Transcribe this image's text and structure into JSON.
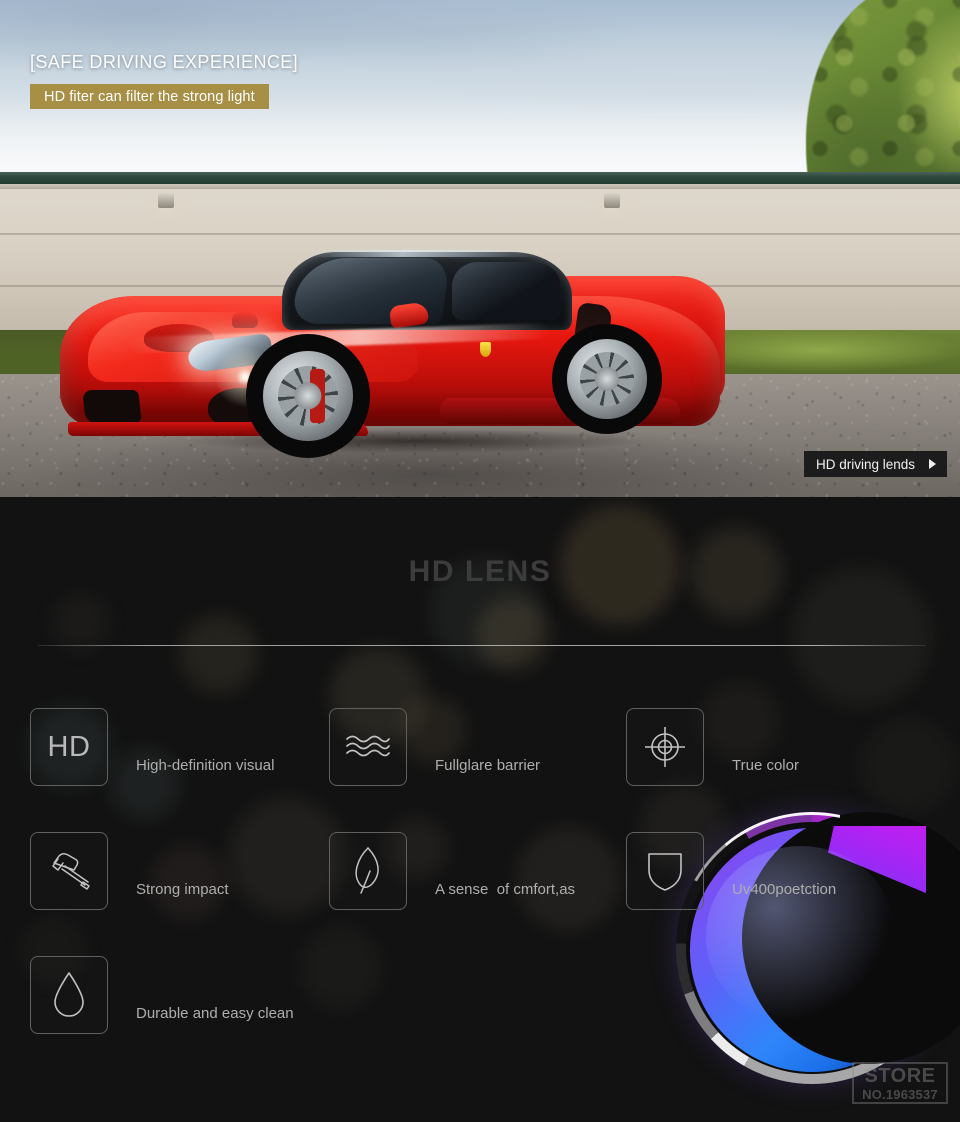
{
  "hero": {
    "kicker": "[SAFE DRIVING EXPERIENCE]",
    "band": "HD fiter can filter the strong light",
    "cta_label": "HD driving lends",
    "cta_icon": "play-triangle-icon",
    "band_color": "#a88f46",
    "cta_bg": "#1c1c1c",
    "scene": {
      "subject": "red-sports-car",
      "car_color": "#e8170f",
      "sky_color": "#bccdda",
      "wall_color": "#d9d1c4",
      "grass_color": "#62792f",
      "road_color": "#8e8781",
      "tree_color": "#5e7c30"
    }
  },
  "features_section": {
    "title": "HD LENS",
    "title_color": "#3c3c3c",
    "background": "#121212",
    "divider_color": "#c3c3c3",
    "items": [
      {
        "icon": "hd-icon",
        "icon_text": "HD",
        "label": "High-definition visual"
      },
      {
        "icon": "waves-icon",
        "icon_text": "",
        "label": "Fullglare barrier"
      },
      {
        "icon": "crosshair-icon",
        "icon_text": "",
        "label": "True color"
      },
      {
        "icon": "hammer-icon",
        "icon_text": "",
        "label": "Strong impact"
      },
      {
        "icon": "leaf-icon",
        "icon_text": "",
        "label": "A sense  of cmfort,as"
      },
      {
        "icon": "shield-icon",
        "icon_text": "",
        "label": "Uv400poetction"
      },
      {
        "icon": "water-drop-icon",
        "icon_text": "",
        "label": "Durable and easy clean"
      }
    ],
    "product_image": {
      "name": "lens-photo",
      "gradient_start": "#8f45f0",
      "gradient_end": "#1b6fe8"
    }
  },
  "watermark": {
    "line1": "STORE",
    "line2": "NO.1963537"
  }
}
